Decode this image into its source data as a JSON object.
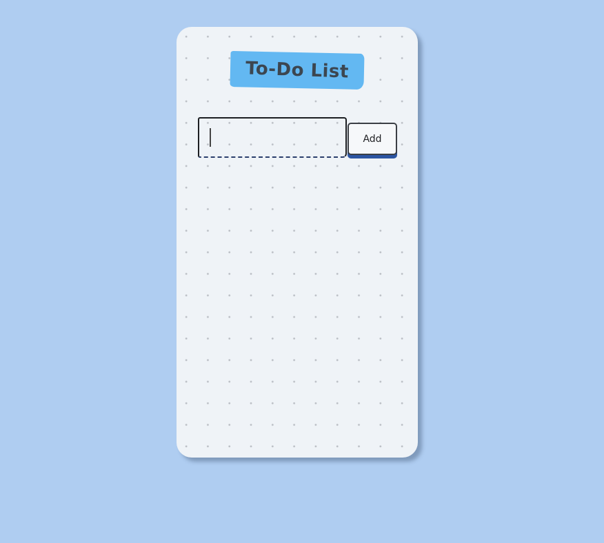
{
  "app": {
    "title": "To-Do List"
  },
  "input": {
    "value": "",
    "placeholder": ""
  },
  "add_button": {
    "label": "Add"
  },
  "colors": {
    "page_background": "#afcdf1",
    "card_background": "#eff3f7",
    "title_highlight": "#63b8f2",
    "button_shadow": "#2c55a2",
    "dot_grid": "#bcc0c6"
  },
  "tasks": []
}
